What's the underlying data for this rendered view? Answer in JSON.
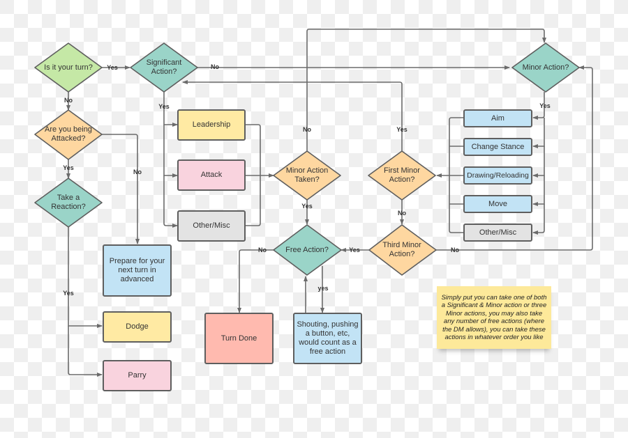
{
  "colors": {
    "green": "#c5e8a6",
    "teal": "#9ad4c8",
    "orange": "#fed7a0",
    "yellow": "#ffeaa3",
    "pink": "#f9d3de",
    "gray": "#e3e3e3",
    "blue": "#c2e3f5",
    "red": "#ffbaaf",
    "line": "#6b6b6b"
  },
  "decisions": {
    "your_turn": "Is it your turn?",
    "significant": "Significant Action?",
    "attacked": "Are you being Attacked?",
    "reaction": "Take a Reaction?",
    "minor_taken": "Minor Action Taken?",
    "free": "Free Action?",
    "third_minor": "Third Minor Action?",
    "first_minor": "First Minor Action?",
    "minor": "Minor Action?"
  },
  "boxes": {
    "leadership": "Leadership",
    "attack": "Attack",
    "other_sig": "Other/Misc",
    "prepare": "Prepare for your next turn in advanced",
    "dodge": "Dodge",
    "parry": "Parry",
    "turn_done": "Turn Done",
    "shouting": "Shouting, pushing a button, etc, would count as a free action",
    "aim": "Aim",
    "change_stance": "Change Stance",
    "drawing": "Drawing/Reloading",
    "move": "Move",
    "other_minor": "Other/Misc"
  },
  "edge_labels": {
    "yes": "Yes",
    "no": "No",
    "yes_lower": "yes"
  },
  "note": "Simply put you can take one of both a Significant & Minor action or three Minor actions, you may also take any number of free actions (where the DM allows), you can take these actions in whatever order you like"
}
